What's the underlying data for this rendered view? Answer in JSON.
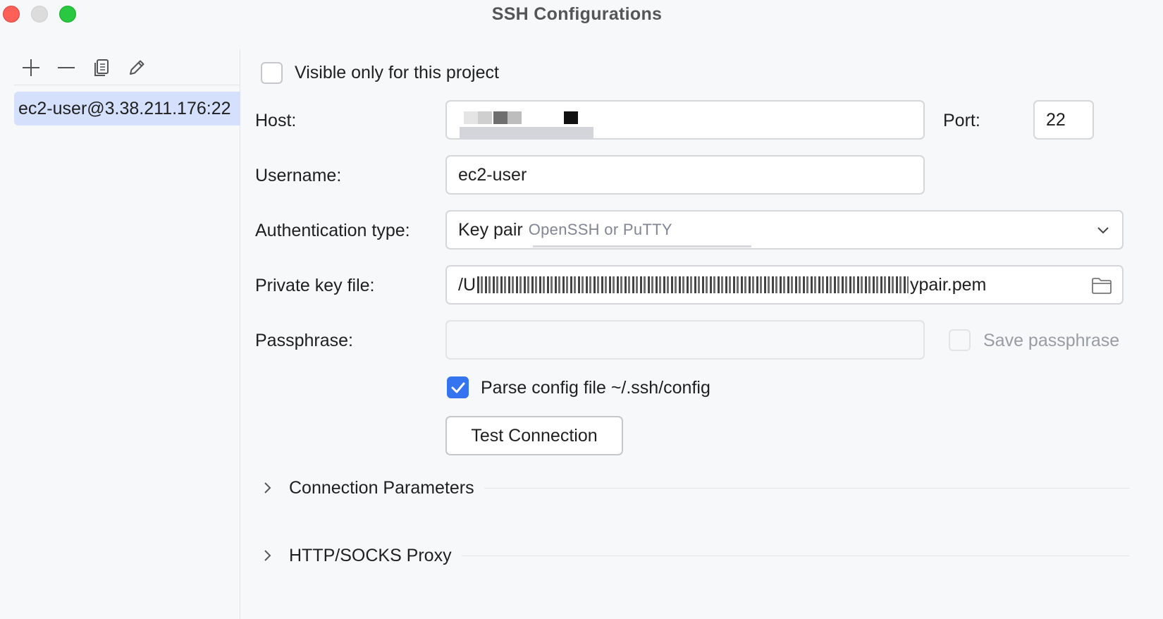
{
  "window": {
    "title": "SSH Configurations"
  },
  "toolbar": {
    "add_icon": "plus-icon",
    "remove_icon": "minus-icon",
    "copy_icon": "copy-icon",
    "edit_icon": "pencil-icon"
  },
  "connections": [
    {
      "label": "ec2-user@3.38.211.176:22"
    }
  ],
  "form": {
    "visible_only_label": "Visible only for this project",
    "visible_only_checked": false,
    "host_label": "Host:",
    "host_value": "",
    "port_label": "Port:",
    "port_value": "22",
    "username_label": "Username:",
    "username_value": "ec2-user",
    "auth_label": "Authentication type:",
    "auth_value": "Key pair",
    "auth_hint": "OpenSSH or PuTTY",
    "key_label": "Private key file:",
    "key_value_prefix": "/U",
    "key_value_suffix": "ypair.pem",
    "pass_label": "Passphrase:",
    "pass_value": "",
    "save_pass_label": "Save passphrase",
    "save_pass_checked": false,
    "parse_config_label": "Parse config file ~/.ssh/config",
    "parse_config_checked": true,
    "test_button": "Test Connection"
  },
  "sections": [
    {
      "title": "Connection Parameters",
      "expanded": false
    },
    {
      "title": "HTTP/SOCKS Proxy",
      "expanded": false
    }
  ],
  "colors": {
    "accent": "#3574f0",
    "selection": "#d4e0fc",
    "close": "#fe5f57",
    "maximize": "#28c840"
  }
}
